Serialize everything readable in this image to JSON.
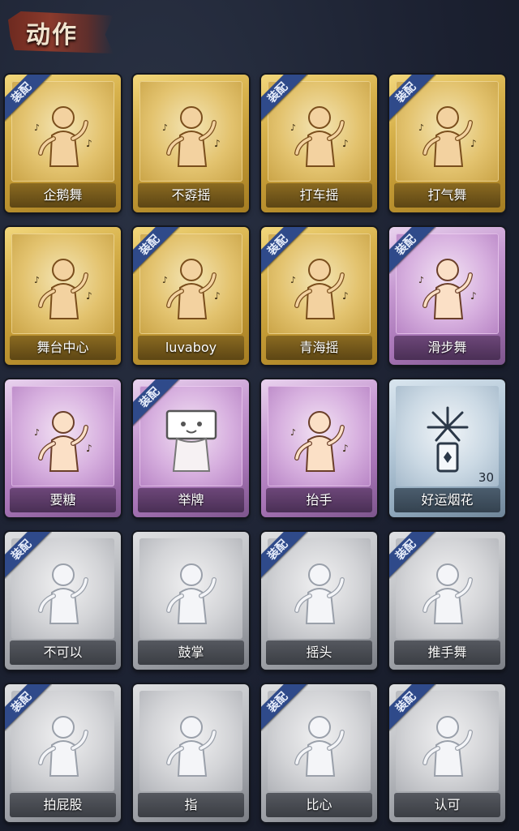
{
  "header": {
    "title": "动作"
  },
  "badge_label": "装配",
  "cards": [
    {
      "label": "企鹅舞",
      "tier": "gold",
      "equipped": true,
      "icon": "penguin-dance-icon",
      "count": ""
    },
    {
      "label": "不孬摇",
      "tier": "gold",
      "equipped": false,
      "icon": "dance-music-icon",
      "count": ""
    },
    {
      "label": "打车摇",
      "tier": "gold",
      "equipped": true,
      "icon": "taxi-shake-icon",
      "count": ""
    },
    {
      "label": "打气舞",
      "tier": "gold",
      "equipped": true,
      "icon": "cheer-dance-icon",
      "count": ""
    },
    {
      "label": "舞台中心",
      "tier": "gold",
      "equipped": false,
      "icon": "stage-center-icon",
      "count": ""
    },
    {
      "label": "luvaboy",
      "tier": "gold",
      "equipped": true,
      "icon": "luvaboy-icon",
      "count": ""
    },
    {
      "label": "青海摇",
      "tier": "gold",
      "equipped": true,
      "icon": "qinghai-shake-icon",
      "count": ""
    },
    {
      "label": "滑步舞",
      "tier": "purple",
      "equipped": true,
      "icon": "slide-dance-icon",
      "count": ""
    },
    {
      "label": "要糖",
      "tier": "purple",
      "equipped": false,
      "icon": "ask-candy-icon",
      "count": ""
    },
    {
      "label": "举牌",
      "tier": "purple",
      "equipped": true,
      "icon": "hold-sign-icon",
      "count": ""
    },
    {
      "label": "抬手",
      "tier": "purple",
      "equipped": false,
      "icon": "raise-hand-icon",
      "count": ""
    },
    {
      "label": "好运烟花",
      "tier": "blue",
      "equipped": false,
      "icon": "firework-icon",
      "count": "30"
    },
    {
      "label": "不可以",
      "tier": "gray",
      "equipped": true,
      "icon": "no-finger-icon",
      "count": ""
    },
    {
      "label": "鼓掌",
      "tier": "gray",
      "equipped": false,
      "icon": "clap-icon",
      "count": ""
    },
    {
      "label": "摇头",
      "tier": "gray",
      "equipped": true,
      "icon": "shake-head-icon",
      "count": ""
    },
    {
      "label": "推手舞",
      "tier": "gray",
      "equipped": true,
      "icon": "push-hand-dance-icon",
      "count": ""
    },
    {
      "label": "拍屁股",
      "tier": "gray",
      "equipped": true,
      "icon": "pat-butt-icon",
      "count": ""
    },
    {
      "label": "指",
      "tier": "gray",
      "equipped": false,
      "icon": "point-icon",
      "count": ""
    },
    {
      "label": "比心",
      "tier": "gray",
      "equipped": true,
      "icon": "heart-finger-icon",
      "count": ""
    },
    {
      "label": "认可",
      "tier": "gray",
      "equipped": true,
      "icon": "thumbs-up-icon",
      "count": ""
    }
  ]
}
